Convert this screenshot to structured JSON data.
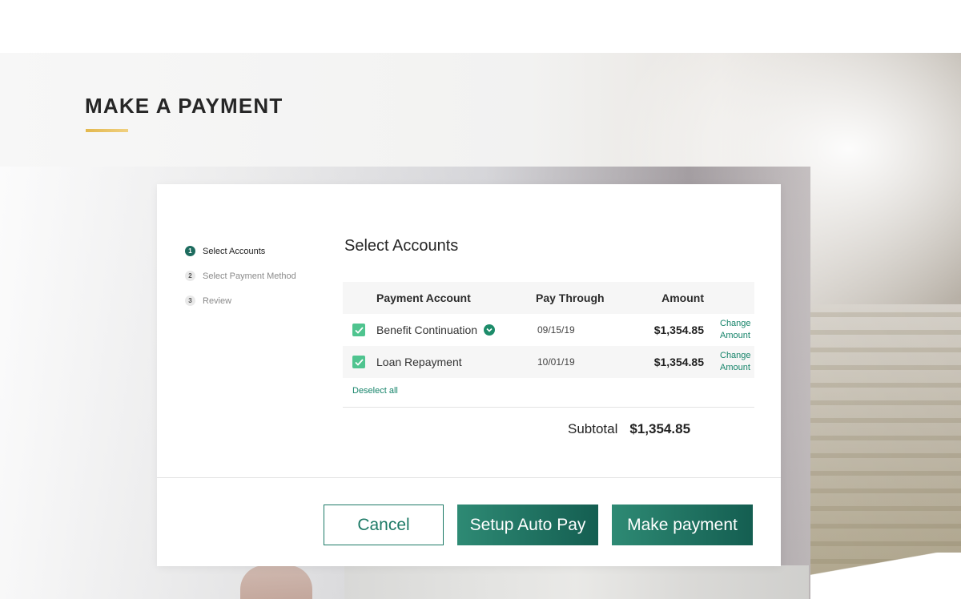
{
  "page": {
    "title": "MAKE A PAYMENT"
  },
  "steps": [
    {
      "number": "1",
      "label": "Select Accounts",
      "active": true
    },
    {
      "number": "2",
      "label": "Select Payment Method",
      "active": false
    },
    {
      "number": "3",
      "label": "Review",
      "active": false
    }
  ],
  "section": {
    "title": "Select Accounts"
  },
  "table": {
    "headers": {
      "account": "Payment Account",
      "pay_through": "Pay Through",
      "amount": "Amount"
    },
    "rows": [
      {
        "account": "Benefit Continuation",
        "pay_through": "09/15/19",
        "amount": "$1,354.85",
        "action": "Change Amount",
        "checked": true,
        "expandable": true
      },
      {
        "account": "Loan Repayment",
        "pay_through": "10/01/19",
        "amount": "$1,354.85",
        "action": "Change Amount",
        "checked": true,
        "expandable": false
      }
    ],
    "deselect_label": "Deselect all"
  },
  "subtotal": {
    "label": "Subtotal",
    "value": "$1,354.85"
  },
  "buttons": {
    "cancel": "Cancel",
    "auto_pay": "Setup Auto Pay",
    "pay": "Make payment"
  },
  "colors": {
    "brand": "#1d6b5e",
    "checkbox": "#4fc48f",
    "link": "#16846a",
    "accent_underline": "#e3b84e"
  },
  "icons": {
    "checkbox": "check-icon",
    "expand": "chevron-down-icon"
  }
}
